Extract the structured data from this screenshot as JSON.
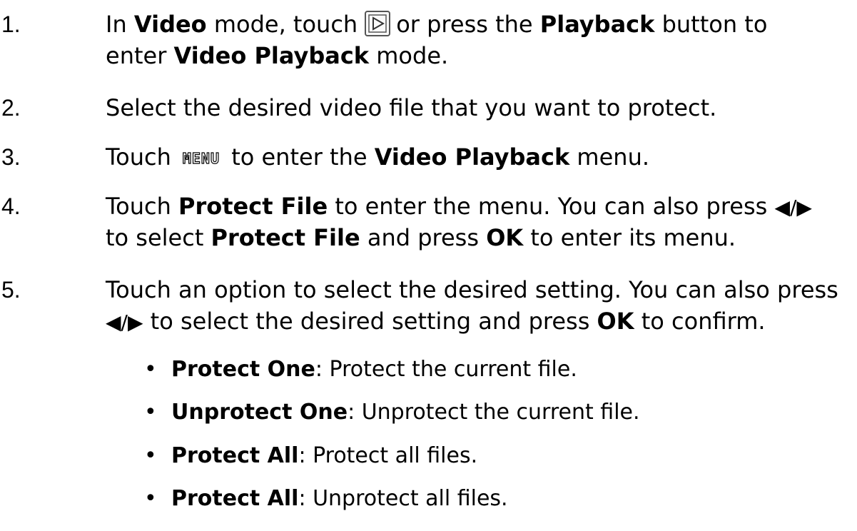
{
  "steps": [
    {
      "number": "1.",
      "line1_a": "In ",
      "line1_b": "Video",
      "line1_c": " mode, touch",
      "line1_d": "or press the ",
      "line1_e": "Playback",
      "line1_f": " button to",
      "line2_a": "enter ",
      "line2_b": "Video Playback",
      "line2_c": " mode.",
      "icon": "playback-icon"
    },
    {
      "number": "2.",
      "text": "Select the desired video file that you want to protect."
    },
    {
      "number": "3.",
      "a": "Touch",
      "menu_icon": "MENU",
      "b": " to enter the ",
      "c": "Video Playback",
      "d": " menu."
    },
    {
      "number": "4.",
      "line1_a": "Touch ",
      "line1_b": "Protect File",
      "line1_c": " to enter the menu. You can also press ",
      "line1_arrows": "◀/▶",
      "line2_a": "to select ",
      "line2_b": "Protect File",
      "line2_c": " and press ",
      "line2_d": "OK",
      "line2_e": " to enter its menu."
    },
    {
      "number": "5.",
      "line1": "Touch an option to select the desired setting. You can also press",
      "line2_arrows": "◀/▶",
      "line2_a": " to select the desired setting and press ",
      "line2_b": "OK",
      "line2_c": " to confirm."
    }
  ],
  "bullets": [
    {
      "term": "Protect One",
      "desc": ": Protect the current file."
    },
    {
      "term": "Unprotect One",
      "desc": ": Unprotect the current file."
    },
    {
      "term": "Protect All",
      "desc": ": Protect all files."
    },
    {
      "term": "Protect All",
      "desc": ": Unprotect all files."
    }
  ],
  "bullet_char": "•"
}
